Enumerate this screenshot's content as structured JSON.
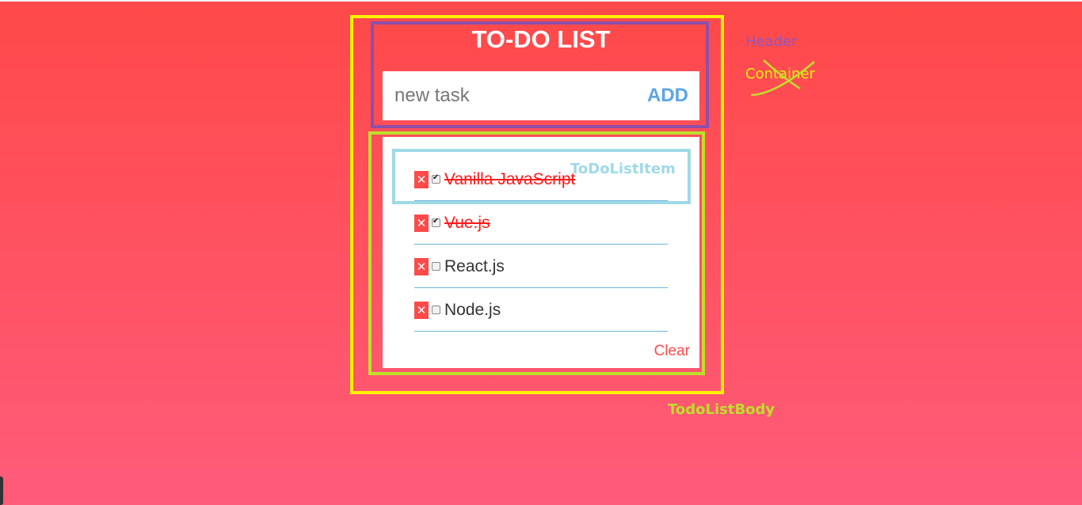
{
  "header": {
    "title": "TO-DO LIST",
    "input_placeholder": "new task",
    "add_label": "ADD"
  },
  "todos": [
    {
      "text": "Vanilla JavaScript",
      "done": true
    },
    {
      "text": "Vue.js",
      "done": true
    },
    {
      "text": "React.js",
      "done": false
    },
    {
      "text": "Node.js",
      "done": false
    }
  ],
  "delete_glyph": "✕",
  "footer": {
    "clear_label": "Clear"
  },
  "annotations": {
    "header": "Header",
    "container": "Container",
    "item": "ToDoListItem",
    "body": "TodoListBody"
  },
  "colors": {
    "container_outline": "#fff200",
    "header_outline": "#8e4fa8",
    "body_outline": "#bddf2b",
    "item_outline": "#9fd9e8",
    "done_text": "#ff1a1a",
    "add_button": "#5aa6e6",
    "delete_button": "#ff4a4a"
  }
}
